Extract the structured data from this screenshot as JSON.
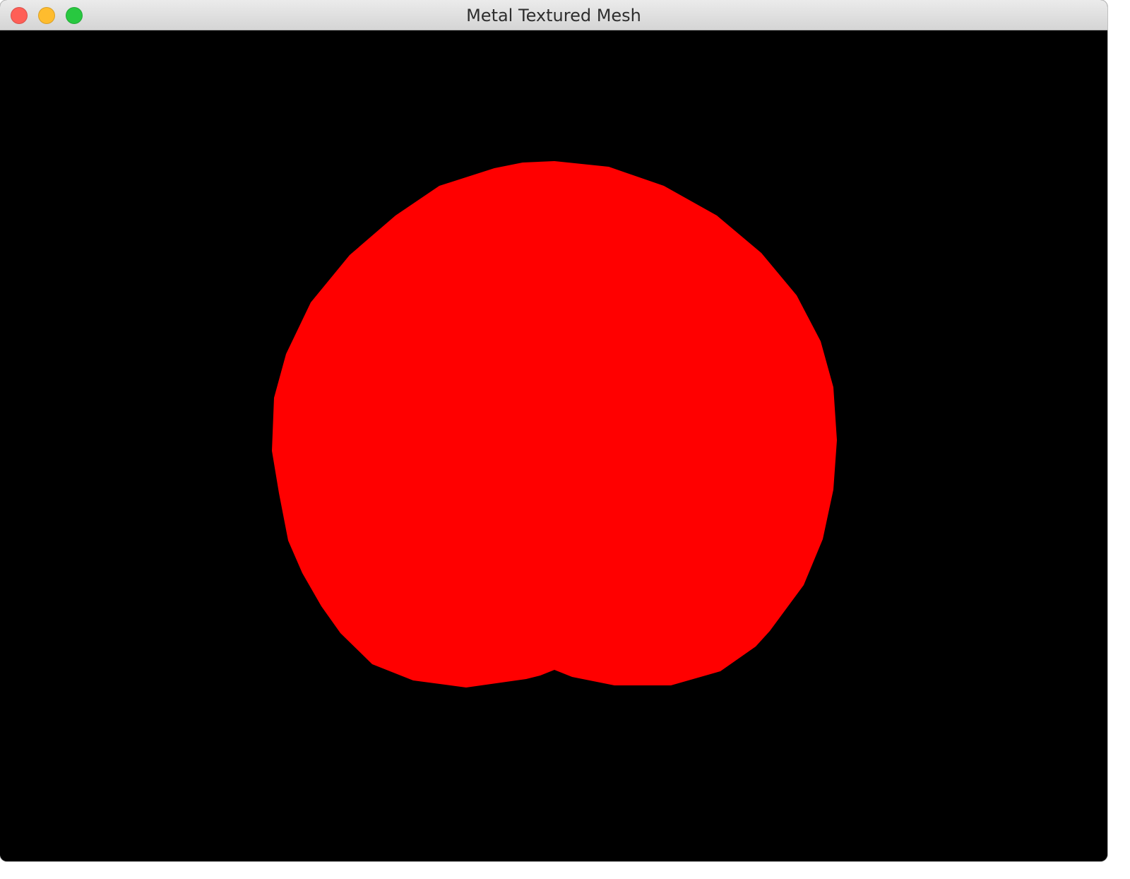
{
  "window": {
    "title": "Metal Textured Mesh",
    "controls": {
      "close_color": "#ff5f57",
      "minimize_color": "#febc2e",
      "zoom_color": "#28c840"
    }
  },
  "viewport": {
    "background_color": "#000000",
    "mesh_color": "#ff0000"
  }
}
